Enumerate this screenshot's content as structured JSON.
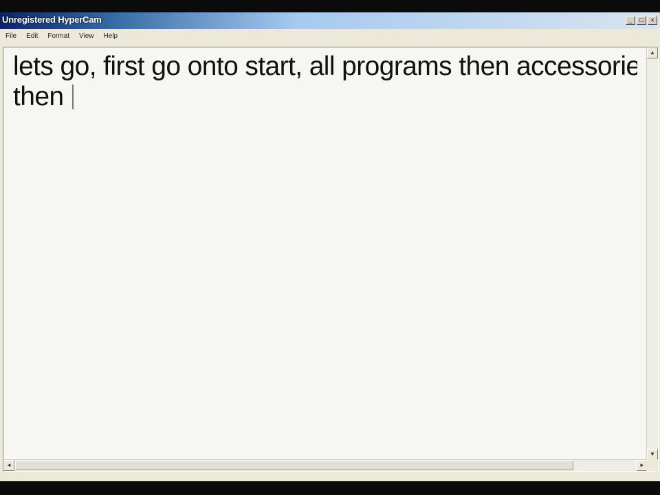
{
  "window": {
    "title": "Unregistered HyperCam",
    "controls": {
      "minimize": "_",
      "maximize": "□",
      "close": "×"
    }
  },
  "menu": [
    "File",
    "Edit",
    "Format",
    "View",
    "Help"
  ],
  "editor": {
    "lines": [
      "lets go, first go onto start, all programs then accessories",
      "then"
    ]
  },
  "scrollbars": {
    "up_arrow": "▲",
    "down_arrow": "▼",
    "left_arrow": "◄",
    "right_arrow": "►"
  }
}
